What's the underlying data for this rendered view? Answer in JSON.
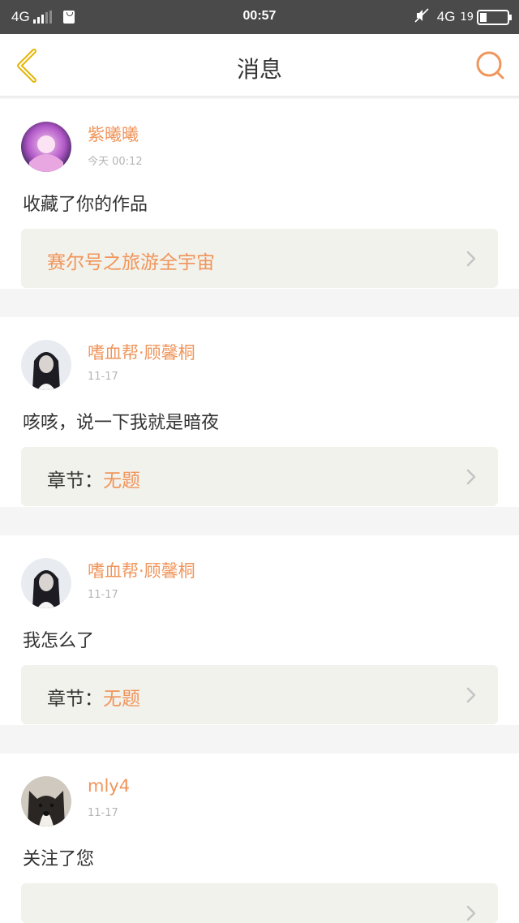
{
  "status_bar": {
    "network_left": "4G",
    "time": "00:57",
    "network_right": "4G",
    "battery": "19"
  },
  "header": {
    "title": "消息"
  },
  "colors": {
    "accent": "#f0955b",
    "back_icon": "#e6b300",
    "reference_bg": "#f2f2ec"
  },
  "messages": [
    {
      "user": "紫曦曦",
      "time": "今天 00:12",
      "text": "收藏了你的作品",
      "ref_prefix": "",
      "ref_title": "赛尔号之旅游全宇宙",
      "avatar": "anime-girl-avatar"
    },
    {
      "user": "嗜血帮·顾馨桐",
      "time": "11-17",
      "text": "咳咳，说一下我就是暗夜",
      "ref_prefix": "章节：",
      "ref_title": "无题",
      "avatar": "dark-hair-avatar"
    },
    {
      "user": "嗜血帮·顾馨桐",
      "time": "11-17",
      "text": "我怎么了",
      "ref_prefix": "章节：",
      "ref_title": "无题",
      "avatar": "dark-hair-avatar"
    },
    {
      "user": "mly4",
      "time": "11-17",
      "text": "关注了您",
      "ref_prefix": "",
      "ref_title": "",
      "avatar": "husky-dog-avatar"
    }
  ]
}
